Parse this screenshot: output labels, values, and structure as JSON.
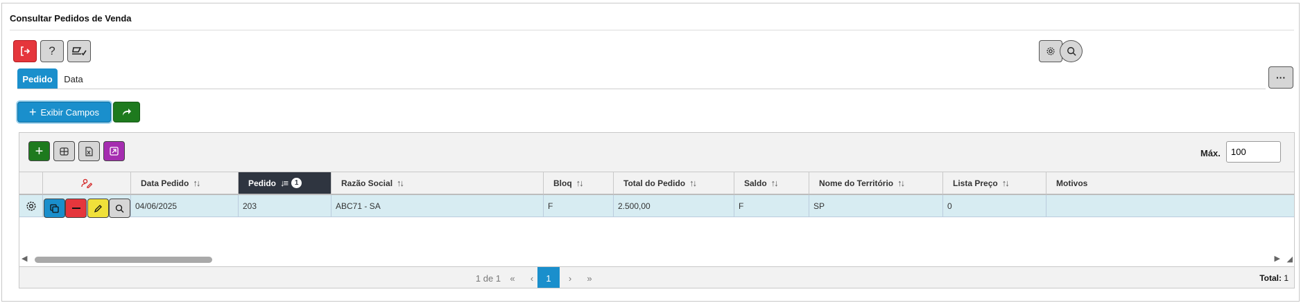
{
  "page": {
    "title": "Consultar Pedidos de Venda"
  },
  "tabs": [
    {
      "label": "Pedido",
      "active": true
    },
    {
      "label": "Data",
      "active": false
    }
  ],
  "actions": {
    "exibir_campos_label": "Exibir Campos"
  },
  "grid": {
    "max_label": "Máx.",
    "max_value": "100",
    "columns": [
      "Data Pedido",
      "Pedido",
      "Razão Social",
      "Bloq",
      "Total do Pedido",
      "Saldo",
      "Nome do Território",
      "Lista Preço",
      "Motivos"
    ],
    "sorted_column_badge": "1",
    "rows": [
      [
        "04/06/2025",
        "203",
        "ABC71 - SA",
        "F",
        "2.500,00",
        "F",
        "SP",
        "0",
        ""
      ]
    ],
    "pagination": {
      "info": "1 de 1",
      "first": "«",
      "prev": "‹",
      "current": "1",
      "next": "›",
      "last": "»",
      "total_label": "Total:",
      "total_value": "1"
    }
  },
  "colors": {
    "primary": "#1a8fcc",
    "success": "#1e7a1e",
    "danger": "#e5363c",
    "warning": "#f0e03a",
    "magenta": "#a52db0",
    "row_bg": "#d7ecf2",
    "header_sorted": "#2f3540"
  }
}
